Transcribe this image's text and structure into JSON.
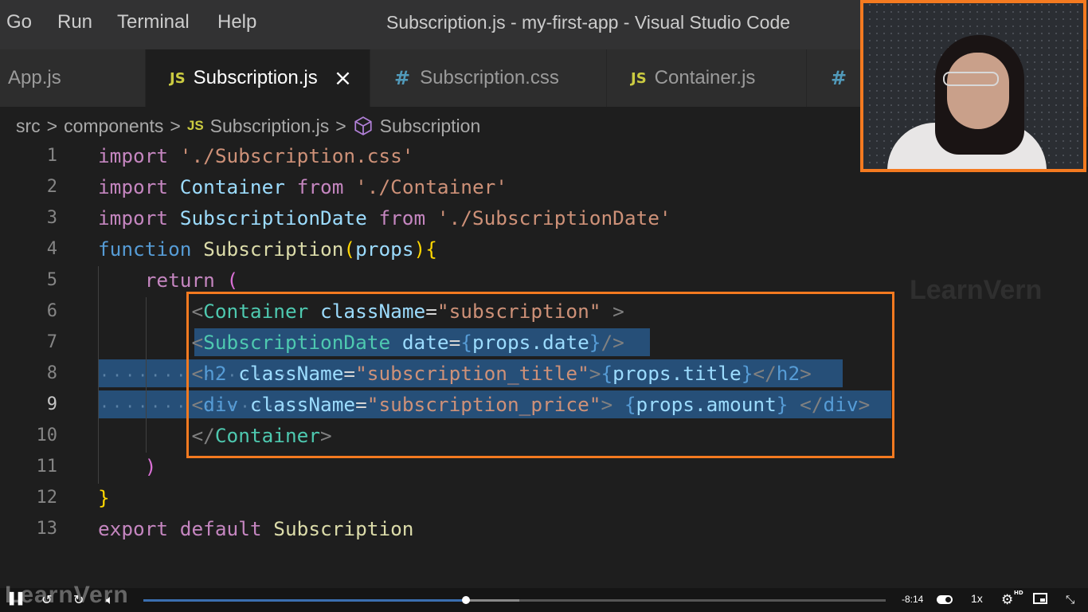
{
  "menubar": {
    "items": [
      "Go",
      "Run",
      "Terminal",
      "Help"
    ],
    "window_title": "Subscription.js - my-first-app - Visual Studio Code"
  },
  "tabs": [
    {
      "label": "App.js",
      "icon": "js-file-icon",
      "active": false
    },
    {
      "label": "Subscription.js",
      "icon": "js-file-icon",
      "icon_text": "JS",
      "active": true,
      "close": "×"
    },
    {
      "label": "Subscription.css",
      "icon": "css-file-icon",
      "icon_text": "#",
      "active": false
    },
    {
      "label": "Container.js",
      "icon": "js-file-icon",
      "icon_text": "JS",
      "active": false
    },
    {
      "label": "",
      "icon": "css-file-icon",
      "icon_text": "#",
      "active": false
    }
  ],
  "breadcrumb": {
    "items": [
      "src",
      "components",
      "Subscription.js",
      "Subscription"
    ],
    "js_icon_text": "JS",
    "separator": ">"
  },
  "editor": {
    "line_numbers": [
      "1",
      "2",
      "3",
      "4",
      "5",
      "6",
      "7",
      "8",
      "9",
      "10",
      "11",
      "12",
      "13"
    ],
    "current_line": "9",
    "lines": [
      "import './Subscription.css'",
      "import Container from './Container'",
      "import SubscriptionDate from './SubscriptionDate'",
      "function Subscription(props){",
      "    return (",
      "        <Container className=\"subscription\" >",
      "        <SubscriptionDate date={props.date}/>",
      "        <h2 className=\"subscription_title\">{props.title}</h2>",
      "        <div className=\"subscription_price\"> {props.amount} </div>",
      "        </Container>",
      "    )",
      "}",
      "export default Subscription"
    ]
  },
  "watermark": "LearnVern",
  "video_controls": {
    "logo": "LearnVern",
    "time_remaining": "-8:14",
    "speed": "1x",
    "hd_badge": "HD",
    "progress_fraction": 0.435,
    "buffered_fraction": 0.506
  },
  "colors": {
    "accent_border": "#f47a20",
    "editor_bg": "#1e1e1e",
    "selection": "#264f78",
    "keyword": "#c586c0",
    "string": "#ce9178",
    "class": "#4ec9b0"
  }
}
